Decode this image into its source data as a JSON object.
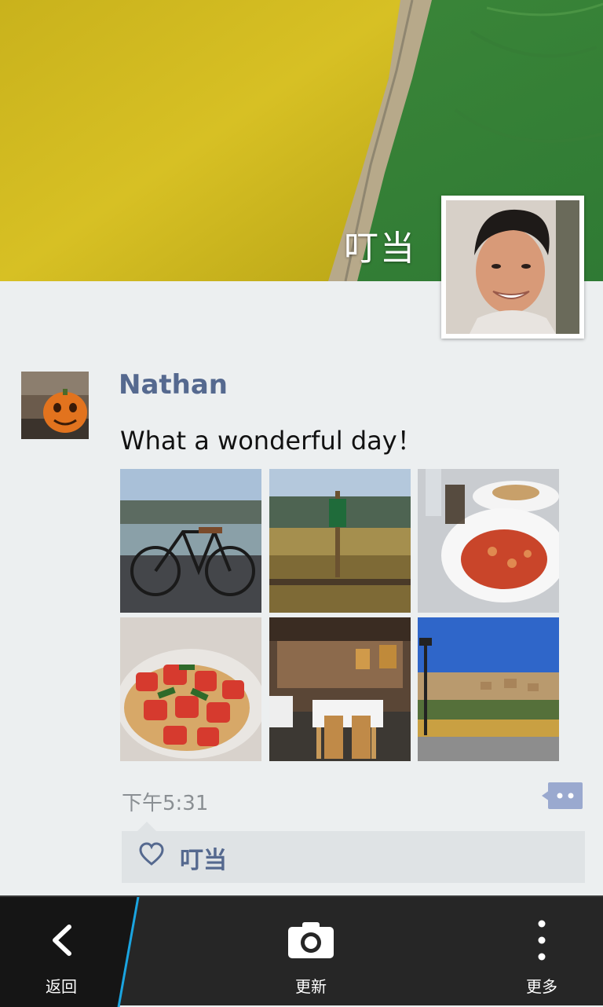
{
  "profile": {
    "owner_name": "叮当"
  },
  "post": {
    "author": "Nathan",
    "text": "What a wonderful day！",
    "timestamp": "下午5:31",
    "photo_count": 6,
    "likes": {
      "names": "叮当"
    }
  },
  "action_bar": {
    "back_label": "返回",
    "update_label": "更新",
    "more_label": "更多"
  },
  "icons": {
    "back": "chevron-left-icon",
    "camera": "camera-icon",
    "more": "vertical-dots-icon",
    "comment": "comment-bubble-icon",
    "like": "heart-outline-icon"
  },
  "colors": {
    "author": "#55698f",
    "accent_blue": "#1aa4e0",
    "bar_background": "#262626",
    "page_background": "#eceff0"
  }
}
